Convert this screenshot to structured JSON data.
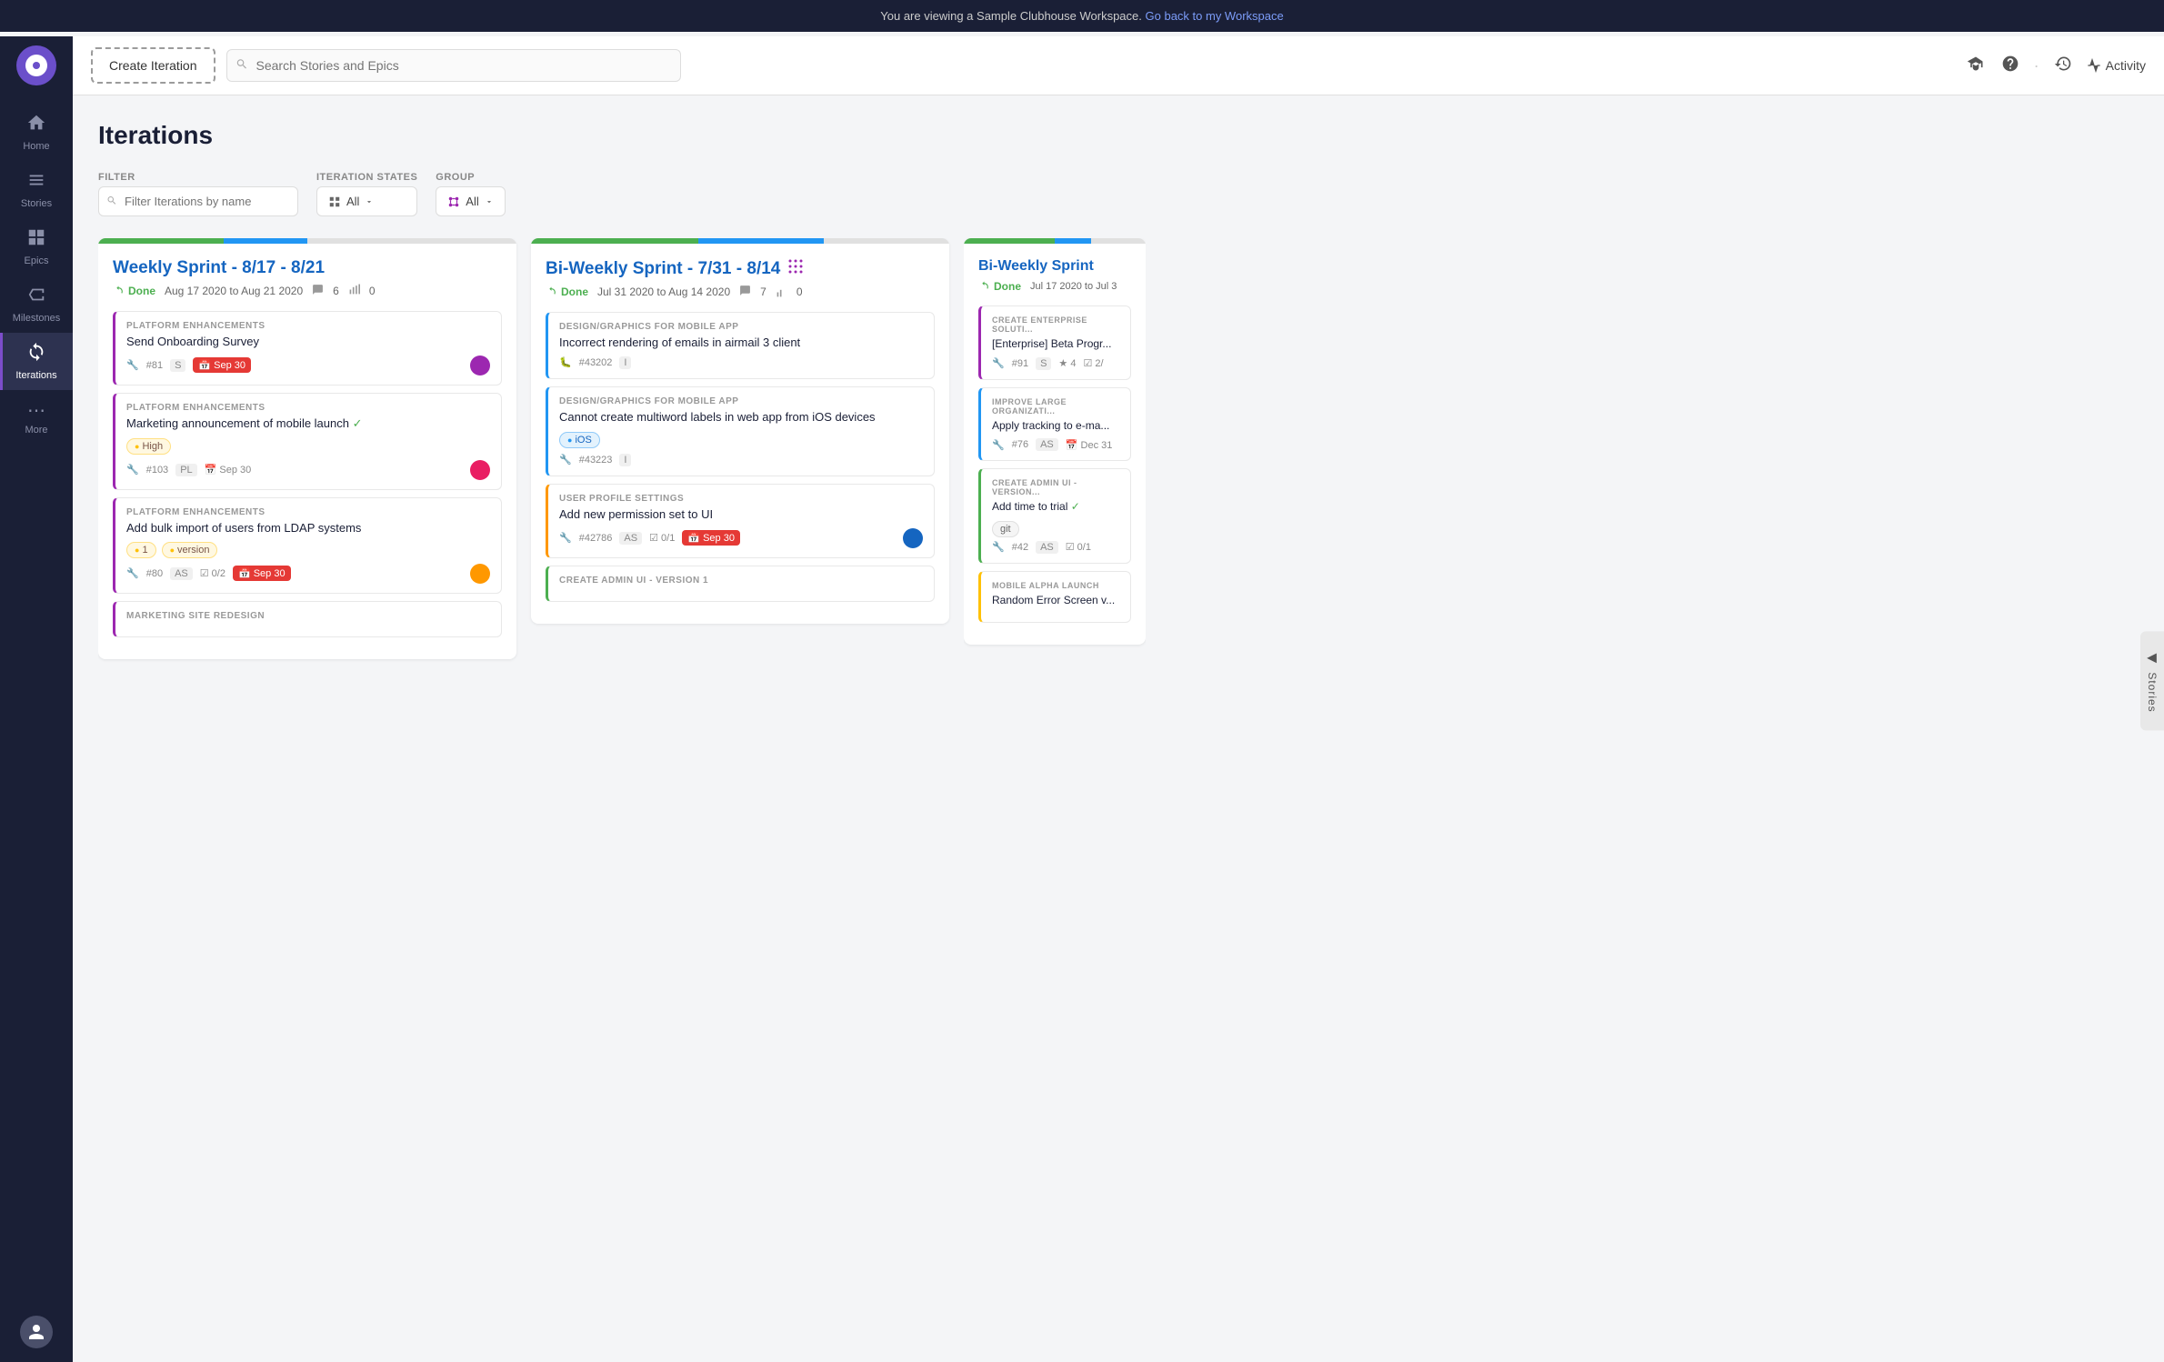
{
  "banner": {
    "text": "You are viewing a Sample Clubhouse Workspace.",
    "link_text": "Go back to my Workspace",
    "link_url": "#"
  },
  "sidebar": {
    "logo_text": "●",
    "nav_items": [
      {
        "id": "home",
        "label": "Home",
        "icon": "⌂",
        "active": false
      },
      {
        "id": "stories",
        "label": "Stories",
        "icon": "☰",
        "active": false
      },
      {
        "id": "epics",
        "label": "Epics",
        "icon": "⊞",
        "active": false
      },
      {
        "id": "milestones",
        "label": "Milestones",
        "icon": "⊟",
        "active": false
      },
      {
        "id": "iterations",
        "label": "Iterations",
        "icon": "◎",
        "active": true
      },
      {
        "id": "more",
        "label": "More",
        "icon": "⋯",
        "active": false
      }
    ]
  },
  "header": {
    "create_iteration_label": "Create Iteration",
    "search_placeholder": "Search Stories and Epics",
    "activity_label": "Activity"
  },
  "page": {
    "title": "Iterations"
  },
  "filter": {
    "filter_label": "FILTER",
    "filter_placeholder": "Filter Iterations by name",
    "iteration_states_label": "ITERATION STATES",
    "iteration_states_value": "All",
    "group_label": "GROUP",
    "group_value": "All"
  },
  "iterations": [
    {
      "id": "col1",
      "title": "Weekly Sprint - 8/17 - 8/21",
      "status": "Done",
      "date_range": "Aug 17 2020 to Aug 21 2020",
      "story_count": "6",
      "points": "0",
      "bar": [
        {
          "color": "#4caf50",
          "flex": 3
        },
        {
          "color": "#2196f3",
          "flex": 2
        },
        {
          "color": "#e0e0e0",
          "flex": 5
        }
      ],
      "stories": [
        {
          "id": "s1",
          "section": "PLATFORM ENHANCEMENTS",
          "title": "Send Onboarding Survey",
          "left_color": "#9c27b0",
          "id_label": "#81",
          "type": "S",
          "date_badge": "Sep 30",
          "date_badge_color": "red",
          "avatar_color": "#9c27b0",
          "icon": "🔧"
        },
        {
          "id": "s2",
          "section": "PLATFORM ENHANCEMENTS",
          "title": "Marketing announcement of mobile launch",
          "checkmark": "✓",
          "left_color": "#9c27b0",
          "priority": "High",
          "priority_color": "yellow",
          "id_label": "#103",
          "type": "PL",
          "date_label": "Sep 30",
          "avatar_color": "#e91e63",
          "icon": "🔧"
        },
        {
          "id": "s3",
          "section": "PLATFORM ENHANCEMENTS",
          "title": "Add bulk import of users from LDAP systems",
          "left_color": "#9c27b0",
          "tags": [
            "1",
            "version"
          ],
          "id_label": "#80",
          "type": "AS",
          "checks": "0/2",
          "date_badge": "Sep 30",
          "date_badge_color": "red",
          "avatar_color": "#ff9800",
          "icon": "🔧"
        },
        {
          "id": "s4",
          "section": "MARKETING SITE REDESIGN",
          "title": "",
          "left_color": "#9c27b0"
        }
      ]
    },
    {
      "id": "col2",
      "title": "Bi-Weekly Sprint - 7/31 - 8/14",
      "status": "Done",
      "date_range": "Jul 31 2020 to Aug 14 2020",
      "story_count": "7",
      "points": "0",
      "group_icon": true,
      "bar": [
        {
          "color": "#4caf50",
          "flex": 4
        },
        {
          "color": "#2196f3",
          "flex": 3
        },
        {
          "color": "#e0e0e0",
          "flex": 3
        }
      ],
      "stories": [
        {
          "id": "s5",
          "section": "DESIGN/GRAPHICS FOR MOBILE APP",
          "title": "Incorrect rendering of emails in airmail 3 client",
          "left_color": "#2196f3",
          "id_label": "#43202",
          "type": "I",
          "icon": "🐛"
        },
        {
          "id": "s6",
          "section": "DESIGN/GRAPHICS FOR MOBILE APP",
          "title": "Cannot create multiword labels in web app from iOS devices",
          "left_color": "#2196f3",
          "tag": "iOS",
          "tag_color": "blue",
          "id_label": "#43223",
          "type": "I",
          "icon": "🔧"
        },
        {
          "id": "s7",
          "section": "USER PROFILE SETTINGS",
          "title": "Add new permission set to UI",
          "left_color": "#ffc107",
          "id_label": "#42786",
          "type": "AS",
          "checks": "0/1",
          "date_badge": "Sep 30",
          "date_badge_color": "red",
          "avatar_color": "#1565c0",
          "icon": "🔧"
        },
        {
          "id": "s8",
          "section": "CREATE ADMIN UI - VERSION 1",
          "title": "",
          "left_color": "#4caf50"
        }
      ]
    },
    {
      "id": "col3",
      "title": "Bi-Weekly Sprint",
      "status": "Done",
      "date_range": "Jul 17 2020 to Jul 3",
      "story_count": "",
      "points": "",
      "partial": true,
      "bar": [
        {
          "color": "#4caf50",
          "flex": 5
        },
        {
          "color": "#2196f3",
          "flex": 2
        },
        {
          "color": "#e0e0e0",
          "flex": 3
        }
      ],
      "stories": [
        {
          "id": "s9",
          "section": "CREATE ENTERPRISE SOLUTI...",
          "title": "[Enterprise] Beta Progr...",
          "left_color": "#9c27b0",
          "id_label": "#91",
          "type": "S",
          "stars": "4",
          "checks": "2/",
          "icon": "🔧"
        },
        {
          "id": "s10",
          "section": "IMPROVE LARGE ORGANIZATI...",
          "title": "Apply tracking to e-ma...",
          "left_color": "#2196f3",
          "id_label": "#76",
          "type": "AS",
          "date_label": "Dec 31",
          "icon": "🔧"
        },
        {
          "id": "s11",
          "section": "CREATE ADMIN UI - VERSION...",
          "title": "Add time to trial",
          "checkmark": "✓",
          "left_color": "#4caf50",
          "tag": "git",
          "tag_color": "gray",
          "id_label": "#42",
          "type": "AS",
          "checks": "0/1",
          "icon": "🔧"
        },
        {
          "id": "s12",
          "section": "MOBILE ALPHA LAUNCH",
          "title": "Random Error Screen v...",
          "left_color": "#ffc107"
        }
      ]
    }
  ],
  "side_toggle": {
    "label": "Stories",
    "arrow": "◀"
  }
}
